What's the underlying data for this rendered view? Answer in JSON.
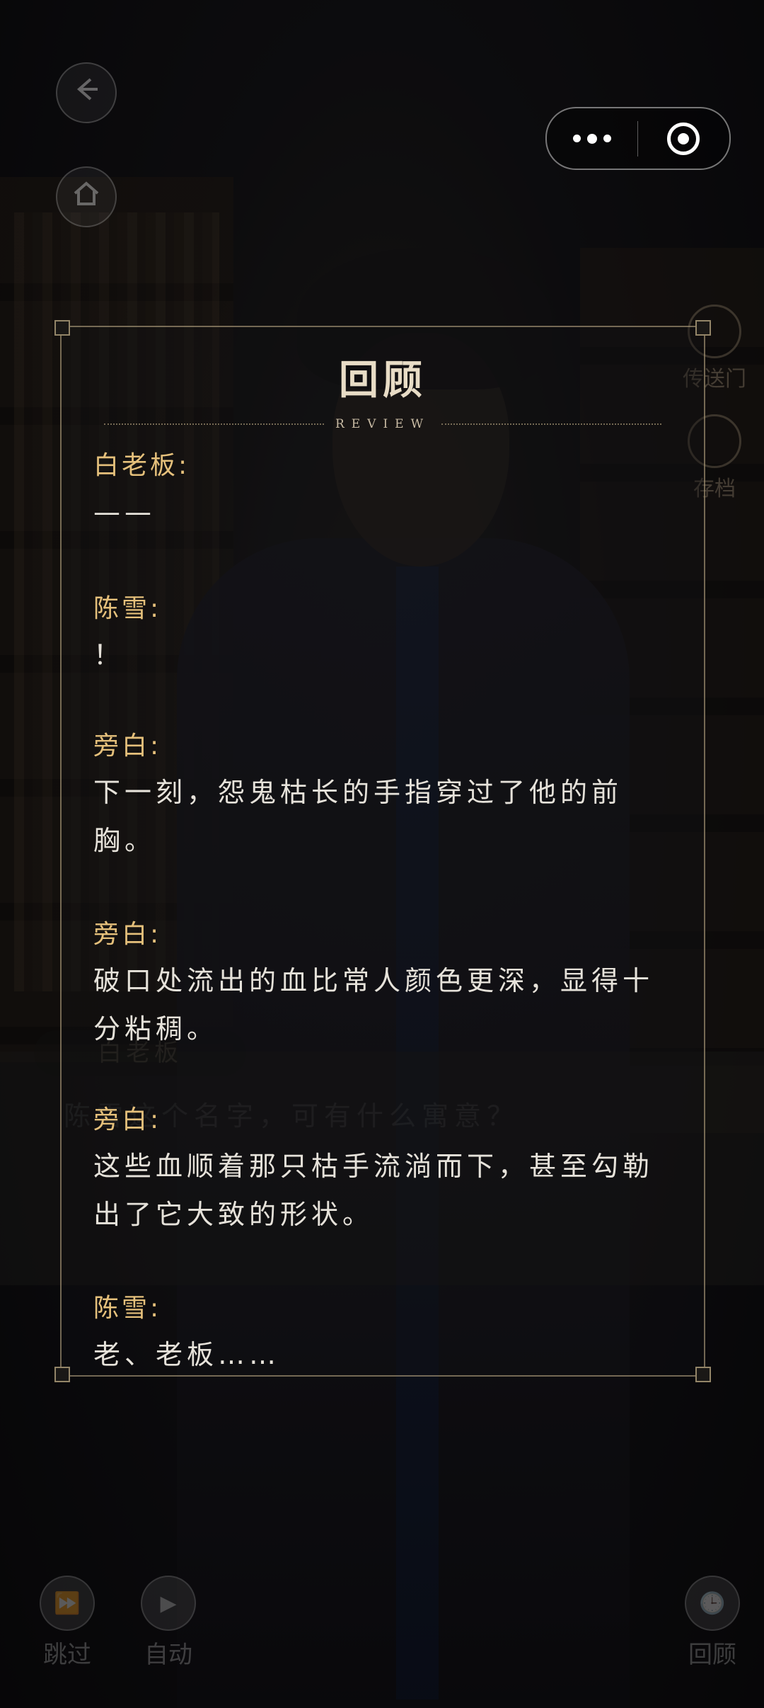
{
  "panel": {
    "title": "回顾",
    "subtitle": "REVIEW"
  },
  "entries": [
    {
      "speaker": "白老板:",
      "text": "——"
    },
    {
      "speaker": "陈雪:",
      "text": "！"
    },
    {
      "speaker": "旁白:",
      "text": "下一刻，怨鬼枯长的手指穿过了他的前胸。"
    },
    {
      "speaker": "旁白:",
      "text": "破口处流出的血比常人颜色更深，显得十分粘稠。"
    },
    {
      "speaker": "旁白:",
      "text": "这些血顺着那只枯手流淌而下，甚至勾勒出了它大致的形状。"
    },
    {
      "speaker": "陈雪:",
      "text": "老、老板……"
    }
  ],
  "side_menu": {
    "teleport_label": "传送门",
    "save_label": "存档"
  },
  "controls": {
    "skip_label": "跳过",
    "auto_label": "自动",
    "review_label": "回顾"
  },
  "background_dialog": {
    "name": "白老板",
    "text": "陈雪这个名字，可有什么寓意？"
  },
  "icons": {
    "back": "back-arrow-icon",
    "home": "home-icon",
    "more": "more-dots-icon",
    "close": "target-circle-icon"
  },
  "colors": {
    "speaker": "#e5c07b",
    "text": "#e6e2da",
    "border": "#c8b48c"
  }
}
